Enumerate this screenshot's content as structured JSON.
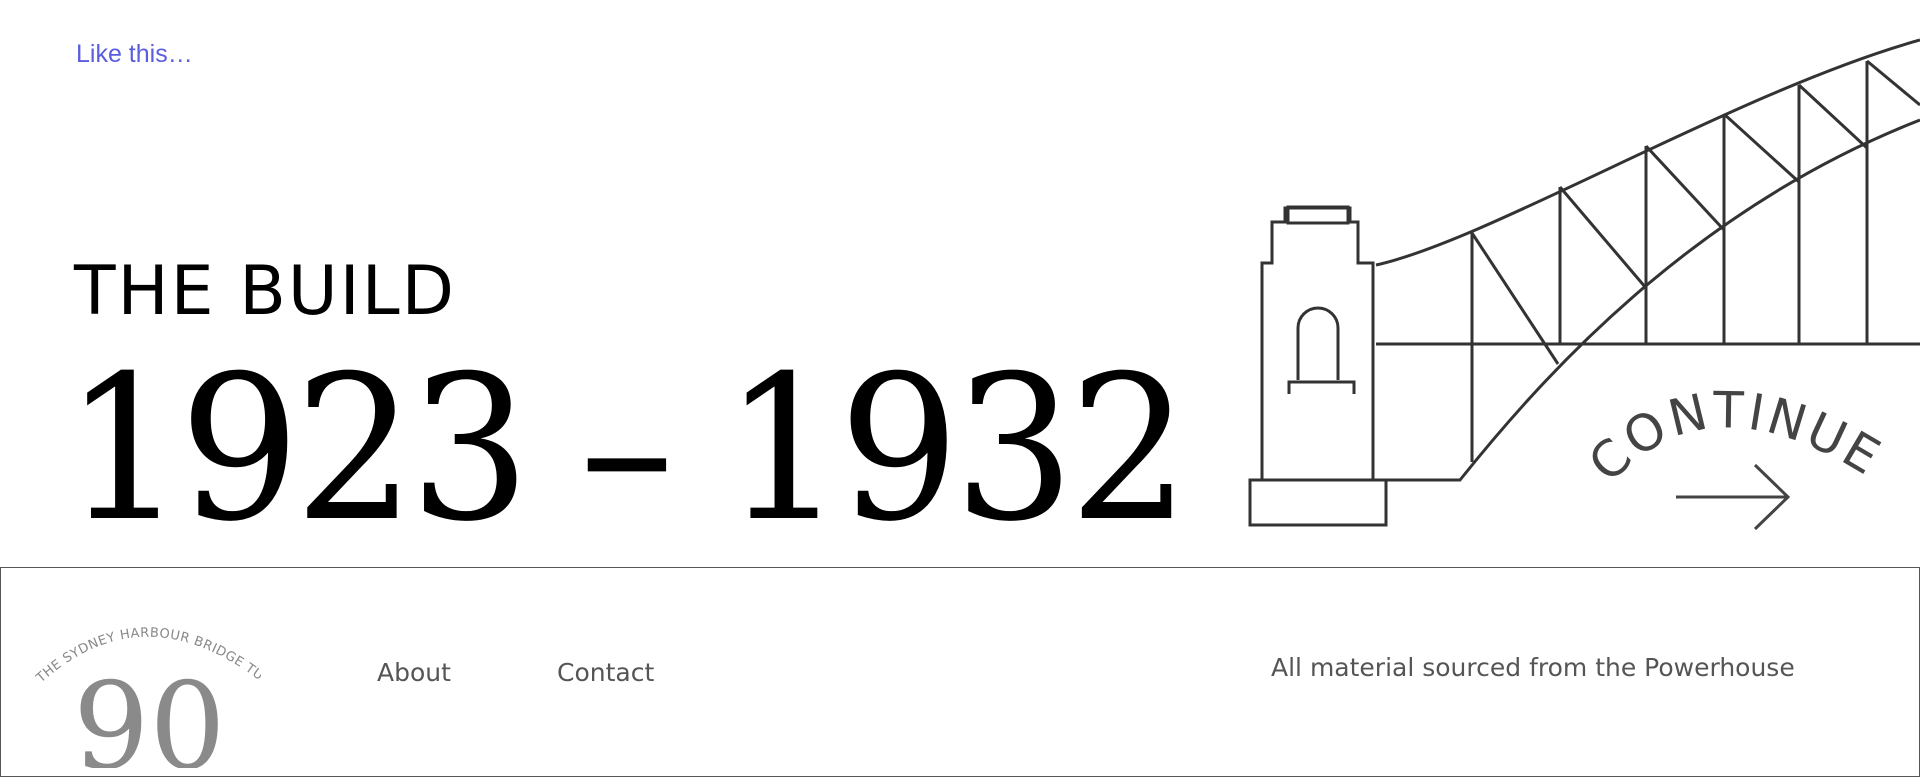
{
  "header": {
    "link_label": "Like this…"
  },
  "hero": {
    "title": "THE BUILD",
    "years": "1923 – 1932"
  },
  "continue": {
    "label": "CONTINUE"
  },
  "footer": {
    "logo_arc_text": "THE SYDNEY HARBOUR BRIDGE TURNS",
    "logo_number": "90",
    "nav": {
      "about": "About",
      "contact": "Contact"
    },
    "credit": "All material sourced from the Powerhouse"
  },
  "colors": {
    "link": "#5a5de0",
    "ink": "#000000",
    "line": "#333333",
    "muted": "#555555",
    "logo_grey": "#8a8a8a"
  }
}
